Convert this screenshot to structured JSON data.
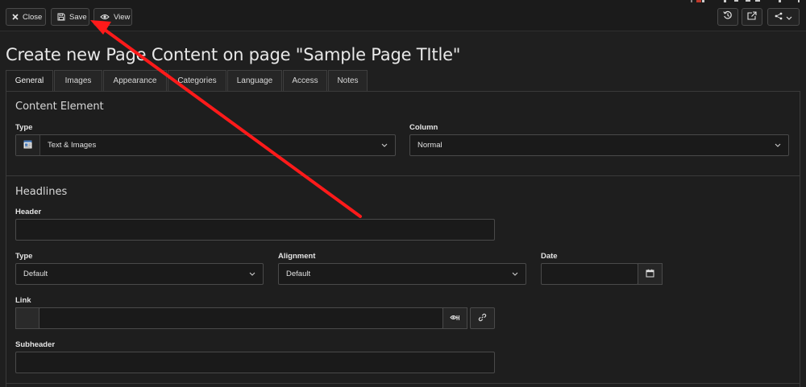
{
  "toolbar": {
    "close_label": "Close",
    "save_label": "Save",
    "view_label": "View"
  },
  "page": {
    "title": "Create new Page Content on page \"Sample Page TItle\""
  },
  "tabs": [
    {
      "label": "General",
      "active": true
    },
    {
      "label": "Images"
    },
    {
      "label": "Appearance"
    },
    {
      "label": "Categories"
    },
    {
      "label": "Language"
    },
    {
      "label": "Access"
    },
    {
      "label": "Notes"
    }
  ],
  "content_element": {
    "section_title": "Content Element",
    "type_label": "Type",
    "type_value": "Text & Images",
    "column_label": "Column",
    "column_value": "Normal"
  },
  "headlines": {
    "section_title": "Headlines",
    "header_label": "Header",
    "header_value": "",
    "type_label": "Type",
    "type_value": "Default",
    "alignment_label": "Alignment",
    "alignment_value": "Default",
    "date_label": "Date",
    "date_value": "",
    "link_label": "Link",
    "link_value": "",
    "subheader_label": "Subheader",
    "subheader_value": ""
  },
  "icons": {
    "close": "close-icon",
    "save": "floppy-disk-icon",
    "view": "eye-icon",
    "history": "history-icon",
    "open": "external-link-icon",
    "share": "share-icon",
    "calendar": "calendar-icon",
    "link": "link-icon",
    "element_browser": "element-browser-icon"
  },
  "colors": {
    "background": "#1f1f1f",
    "annotation_arrow": "#ff1a1a"
  }
}
